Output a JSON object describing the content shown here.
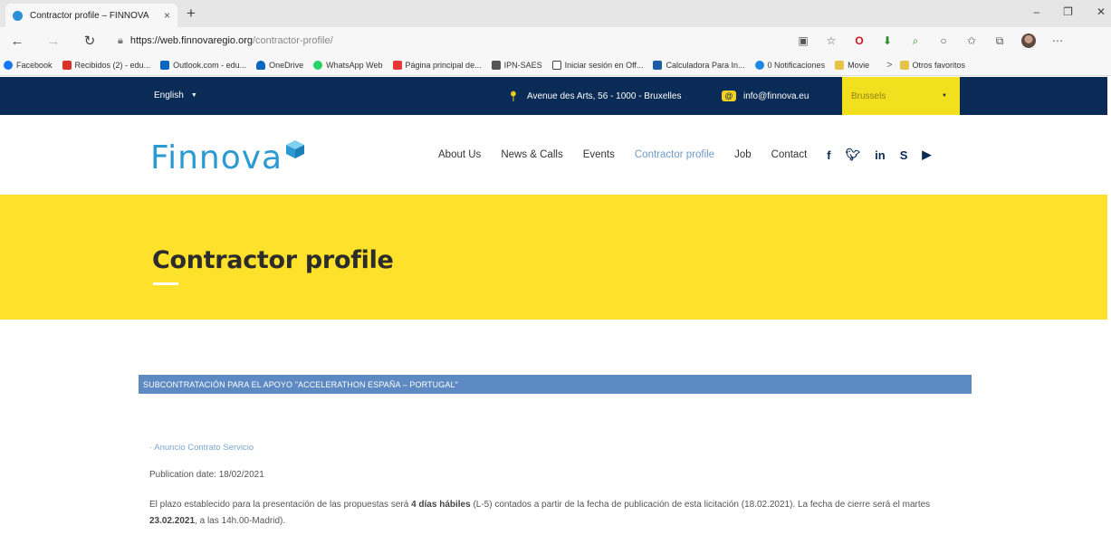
{
  "browser": {
    "tab_title": "Contractor profile – FINNOVA",
    "tab_close": "×",
    "new_tab": "+",
    "window_controls": [
      "–",
      "❐",
      "✕"
    ],
    "url_host": "https://web.finnovaregio.org",
    "url_path": "/contractor-profile/",
    "bookmarks": [
      {
        "label": "Facebook",
        "color": "#1877f2"
      },
      {
        "label": "Recibidos (2) - edu...",
        "color": "#d93025"
      },
      {
        "label": "Outlook.com - edu...",
        "color": "#0a66c2"
      },
      {
        "label": "OneDrive",
        "color": "#0a66c2"
      },
      {
        "label": "WhatsApp Web",
        "color": "#25d366"
      },
      {
        "label": "Página principal de...",
        "color": "#e53935"
      },
      {
        "label": "IPN-SAES",
        "color": "#555555"
      },
      {
        "label": "Iniciar sesión en Off...",
        "color": "#444444"
      },
      {
        "label": "Calculadora Para In...",
        "color": "#1e5aa8"
      },
      {
        "label": "0 Notificaciones",
        "color": "#1e88e5"
      },
      {
        "label": "Movie",
        "color": "#e8c34a"
      }
    ],
    "bookmarks_more": ">",
    "other_favorites": "Otros favoritos"
  },
  "topbar": {
    "language": "English",
    "address": "Avenue des Arts, 56 - 1000 - Bruxelles",
    "email": "info@finnova.eu",
    "city": "Brussels"
  },
  "header": {
    "logo": "Finnova",
    "nav": [
      "About Us",
      "News & Calls",
      "Events",
      "Contractor profile",
      "Job",
      "Contact"
    ],
    "active_nav": "Contractor profile"
  },
  "hero": {
    "title": "Contractor profile"
  },
  "content": {
    "section_title": "SUBCONTRATACIÓN PARA EL APOYO \"ACCELERATHON ESPAÑA – PORTUGAL\"",
    "doc_link": "· Anuncio Contrato Servicio",
    "publication_date": "Publication date: 18/02/2021",
    "para_1": "El plazo establecido para la presentación de las propuestas será ",
    "para_bold_1": "4 días hábiles",
    "para_2": " (L-5) contados a partir de la fecha de publicación de esta licitación (18.02.2021). La fecha de cierre será el martes ",
    "para_bold_2": "23.02.2021",
    "para_3": ", a las 14h.00-Madrid)."
  },
  "colors": {
    "topbar_bg": "#0a2b55",
    "hero_bg": "#fde12a",
    "accent_blue": "#2b9ad3",
    "section_bar": "#5d8ac2"
  }
}
